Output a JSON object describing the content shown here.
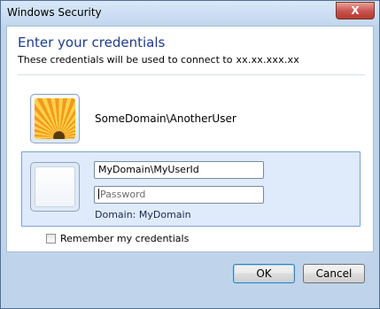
{
  "window": {
    "title": "Windows Security",
    "close_glyph": "X"
  },
  "header": {
    "heading": "Enter your credentials",
    "subtitle": "These credentials will be used to connect to",
    "server": "xx.xx.xxx.xx"
  },
  "saved_user": {
    "name": "SomeDomain\\AnotherUser",
    "icon": "user-picture-flower-icon"
  },
  "credentials": {
    "username_value": "MyDomain\\MyUserId",
    "password_placeholder": "Password",
    "domain_line": "Domain: MyDomain",
    "icon": "blank-user-tile-icon"
  },
  "remember": {
    "label": "Remember my credentials",
    "checked": false
  },
  "buttons": {
    "ok": "OK",
    "cancel": "Cancel"
  },
  "colors": {
    "heading": "#1e3c8c",
    "panel": "#dfeafb",
    "frame": "#bfd4ea",
    "close": "#c75050"
  }
}
